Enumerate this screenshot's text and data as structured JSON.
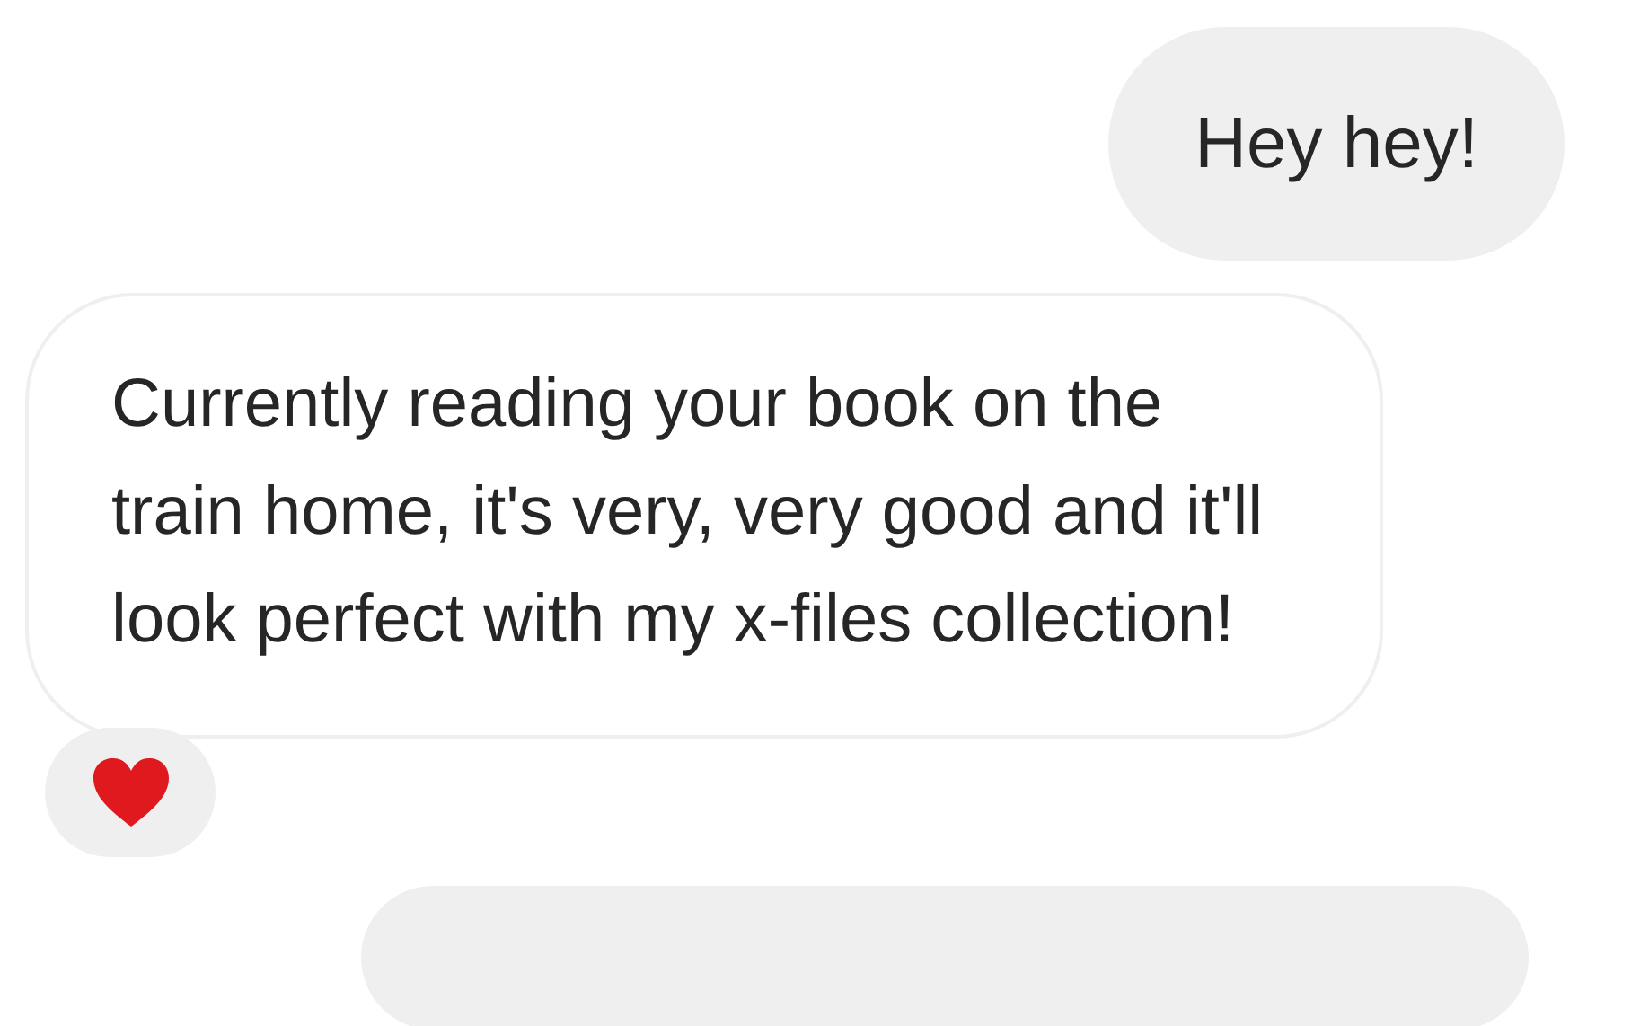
{
  "messages": [
    {
      "kind": "sent",
      "text": "Hey hey!"
    },
    {
      "kind": "received",
      "text": "Currently reading your book on the train home, it's very, very good and it'll look perfect with my x-files collection!",
      "reacted": true
    }
  ]
}
